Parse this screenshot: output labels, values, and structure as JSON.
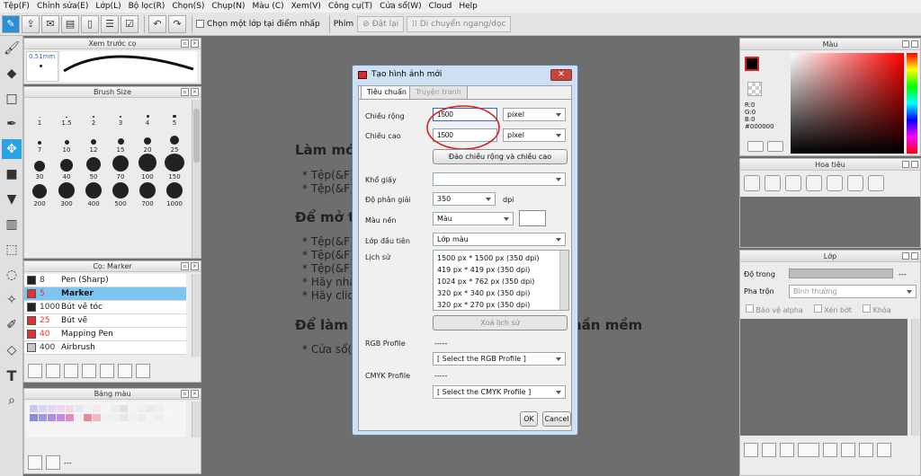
{
  "menu": [
    "Tệp(F)",
    "Chỉnh sửa(E)",
    "Lớp(L)",
    "Bộ lọc(R)",
    "Chọn(S)",
    "Chụp(N)",
    "Màu (C)",
    "Xem(V)",
    "Công cụ(T)",
    "Cửa sổ(W)",
    "Cloud",
    "Help"
  ],
  "toolbar": {
    "pick_layer_label": "Chọn một lớp tại điểm nhấp",
    "shortcut_label": "Phím",
    "reset_label": "Đặt lại",
    "move_label": "Di chuyển ngang/dọc"
  },
  "preview_panel": {
    "title": "Xem trước cọ",
    "size_label": "0.51mm"
  },
  "brushsize_panel": {
    "title": "Brush Size",
    "sizes": [
      "1",
      "1.5",
      "2",
      "3",
      "4",
      "5",
      "7",
      "10",
      "12",
      "15",
      "20",
      "25",
      "30",
      "40",
      "50",
      "70",
      "100",
      "150",
      "200",
      "300",
      "400",
      "500",
      "700",
      "1000"
    ]
  },
  "brush_panel": {
    "title": "Cọ: Marker",
    "items": [
      {
        "size": "8",
        "name": "Pen (Sharp)",
        "color": "#222222"
      },
      {
        "size": "5",
        "name": "Marker",
        "color": "#e53030"
      },
      {
        "size": "1000",
        "name": "Bút vẽ tóc",
        "color": "#222222"
      },
      {
        "size": "25",
        "name": "Bút vẽ",
        "color": "#e53030"
      },
      {
        "size": "40",
        "name": "Mapping Pen",
        "color": "#e53030"
      },
      {
        "size": "400",
        "name": "Airbrush",
        "color": "#c8c8c8"
      }
    ]
  },
  "palette_panel": {
    "title": "Bảng màu",
    "footer": "---"
  },
  "canvas_text": {
    "h1": "Làm mớ",
    "l1": "* Tệp(&F)",
    "l2": "* Tệp(&F)",
    "h2": "Để mở t",
    "l3": "* Tệp(&F)",
    "l4": "* Tệp(&F)",
    "l5": "* Tệp(&F)",
    "l6": "* Hãy nhấ",
    "l7": "* Hãy clic",
    "h3a": "Để làm",
    "h3b": "hần mềm",
    "l8": "* Cửa sổ("
  },
  "dialog": {
    "title": "Tạo hình ảnh mới",
    "tab_standard": "Tiêu chuẩn",
    "tab_comic": "Truyện tranh",
    "width_label": "Chiều rộng",
    "width_value": "1500",
    "height_label": "Chiều cao",
    "height_value": "1500",
    "unit": "pixel",
    "swap_button": "Đảo chiều rộng và chiều cao",
    "paper_label": "Khổ giấy",
    "resolution_label": "Độ phân giải",
    "resolution_value": "350",
    "resolution_unit": "dpi",
    "bg_label": "Màu nền",
    "bg_value": "Màu",
    "first_layer_label": "Lớp đầu tiên",
    "first_layer_value": "Lớp màu",
    "history_label": "Lịch sử",
    "history": [
      "1500 px * 1500 px (350 dpi)",
      "419 px * 419 px (350 dpi)",
      "1024 px * 762 px (350 dpi)",
      "320 px * 340 px (350 dpi)",
      "320 px * 270 px (350 dpi)"
    ],
    "clear_history": "Xoá lịch sử",
    "rgb_label": "RGB Profile",
    "rgb_dash": "-----",
    "rgb_select": "[ Select the RGB Profile ]",
    "cmyk_label": "CMYK Profile",
    "cmyk_dash": "-----",
    "cmyk_select": "[ Select the CMYK Profile ]",
    "ok": "OK",
    "cancel": "Cancel"
  },
  "color_panel": {
    "title": "Màu",
    "r": "R:0",
    "g": "G:0",
    "b": "B:0",
    "hex": "#000000"
  },
  "navigator_panel": {
    "title": "Hoa tiêu"
  },
  "layer_panel": {
    "title": "Lớp",
    "opacity_label": "Độ trong",
    "opacity_value": "---",
    "blend_label": "Pha trộn",
    "blend_value": "Bình thường",
    "protect_alpha": "Bảo vệ alpha",
    "clip": "Xén bớt",
    "lock": "Khóa"
  }
}
